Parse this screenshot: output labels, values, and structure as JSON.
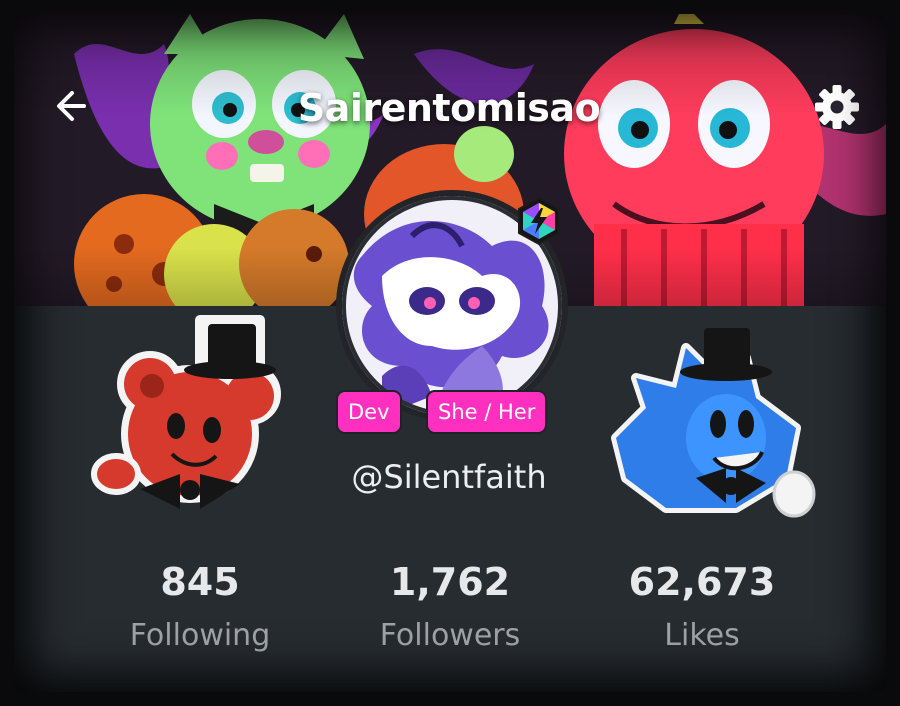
{
  "header": {
    "title": "Sairentomisao",
    "back_icon": "arrow-left-icon",
    "settings_icon": "gear-icon"
  },
  "profile": {
    "tags": [
      "Dev",
      "She / Her"
    ],
    "handle": "@Silentfaith",
    "badge_icon": "lightning-hexagon-badge-icon"
  },
  "stats": [
    {
      "value": "845",
      "label": "Following"
    },
    {
      "value": "1,762",
      "label": "Followers"
    },
    {
      "value": "62,673",
      "label": "Likes"
    }
  ],
  "colors": {
    "tag_background": "#ff2fc0",
    "panel_background": "#272c31",
    "stat_number": "#e6e8ea",
    "stat_label": "#9ea2a7"
  }
}
